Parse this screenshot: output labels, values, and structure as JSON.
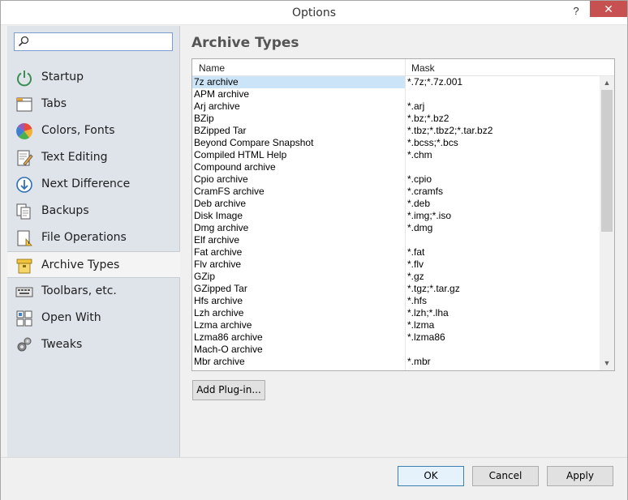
{
  "window": {
    "title": "Options",
    "help_label": "?",
    "close_label": "✕"
  },
  "search": {
    "placeholder": "",
    "value": ""
  },
  "sidebar": {
    "items": [
      {
        "label": "Startup",
        "icon": "power-icon"
      },
      {
        "label": "Tabs",
        "icon": "tabs-icon"
      },
      {
        "label": "Colors, Fonts",
        "icon": "palette-icon"
      },
      {
        "label": "Text Editing",
        "icon": "text-edit-icon"
      },
      {
        "label": "Next Difference",
        "icon": "next-difference-icon"
      },
      {
        "label": "Backups",
        "icon": "backups-icon"
      },
      {
        "label": "File Operations",
        "icon": "file-operations-icon"
      },
      {
        "label": "Archive Types",
        "icon": "archive-icon",
        "selected": true
      },
      {
        "label": "Toolbars, etc.",
        "icon": "keyboard-icon"
      },
      {
        "label": "Open With",
        "icon": "open-with-icon"
      },
      {
        "label": "Tweaks",
        "icon": "gears-icon"
      }
    ]
  },
  "main": {
    "title": "Archive Types",
    "columns": {
      "name": "Name",
      "mask": "Mask"
    },
    "rows": [
      {
        "name": "7z archive",
        "mask": "*.7z;*.7z.001",
        "selected": true
      },
      {
        "name": "APM archive",
        "mask": ""
      },
      {
        "name": "Arj archive",
        "mask": "*.arj"
      },
      {
        "name": "BZip",
        "mask": "*.bz;*.bz2"
      },
      {
        "name": "BZipped Tar",
        "mask": "*.tbz;*.tbz2;*.tar.bz2"
      },
      {
        "name": "Beyond Compare Snapshot",
        "mask": "*.bcss;*.bcs"
      },
      {
        "name": "Compiled HTML Help",
        "mask": "*.chm"
      },
      {
        "name": "Compound archive",
        "mask": ""
      },
      {
        "name": "Cpio archive",
        "mask": "*.cpio"
      },
      {
        "name": "CramFS archive",
        "mask": "*.cramfs"
      },
      {
        "name": "Deb archive",
        "mask": "*.deb"
      },
      {
        "name": "Disk Image",
        "mask": "*.img;*.iso"
      },
      {
        "name": "Dmg archive",
        "mask": "*.dmg"
      },
      {
        "name": "Elf archive",
        "mask": ""
      },
      {
        "name": "Fat archive",
        "mask": "*.fat"
      },
      {
        "name": "Flv archive",
        "mask": "*.flv"
      },
      {
        "name": "GZip",
        "mask": "*.gz"
      },
      {
        "name": "GZipped Tar",
        "mask": "*.tgz;*.tar.gz"
      },
      {
        "name": "Hfs archive",
        "mask": "*.hfs"
      },
      {
        "name": "Lzh archive",
        "mask": "*.lzh;*.lha"
      },
      {
        "name": "Lzma archive",
        "mask": "*.lzma"
      },
      {
        "name": "Lzma86 archive",
        "mask": "*.lzma86"
      },
      {
        "name": "Mach-O archive",
        "mask": ""
      },
      {
        "name": "Mbr archive",
        "mask": "*.mbr"
      }
    ],
    "add_plugin_label": "Add Plug-in..."
  },
  "footer": {
    "ok_label": "OK",
    "cancel_label": "Cancel",
    "apply_label": "Apply"
  },
  "colors": {
    "selection": "#cce4f7",
    "sidebar_bg": "#dfe3ea",
    "close_bg": "#c75050"
  }
}
